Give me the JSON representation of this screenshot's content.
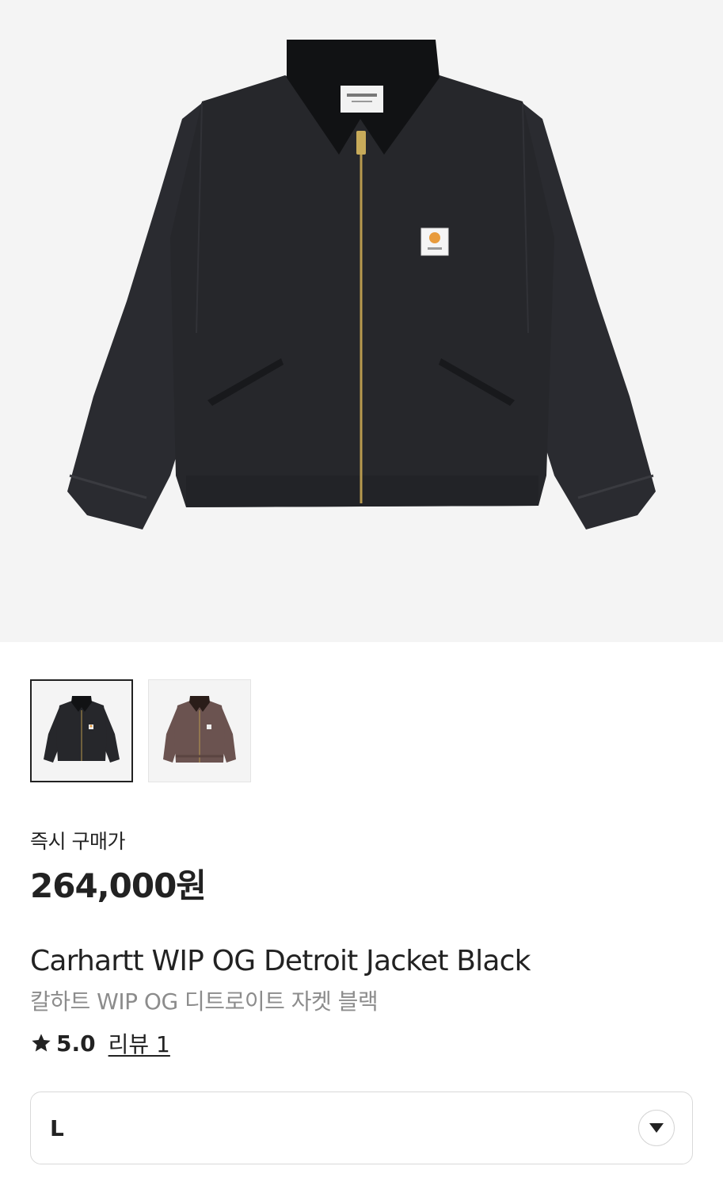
{
  "product": {
    "price_label": "즉시 구매가",
    "price": "264,000원",
    "name_en": "Carhartt WIP OG Detroit Jacket Black",
    "name_ko": "칼하트 WIP OG 디트로이트 자켓 블랙",
    "rating": "5.0",
    "review_link": "리뷰 1"
  },
  "gallery": {
    "thumbnails": [
      {
        "color_name": "black",
        "color": "#26272b",
        "collar": "#111214",
        "selected": true
      },
      {
        "color_name": "brown",
        "color": "#6b5350",
        "collar": "#2a1d19",
        "selected": false
      }
    ]
  },
  "size_select": {
    "selected": "L"
  },
  "colors": {
    "background_gallery": "#f4f4f4",
    "jacket_body": "#26272b",
    "jacket_collar": "#111214",
    "zipper": "#b89a4e",
    "patch_orange": "#e89b3c",
    "secondary_text": "#8c8c8c"
  },
  "icons": {
    "rating": "star-icon",
    "dropdown": "chevron-down-icon"
  }
}
